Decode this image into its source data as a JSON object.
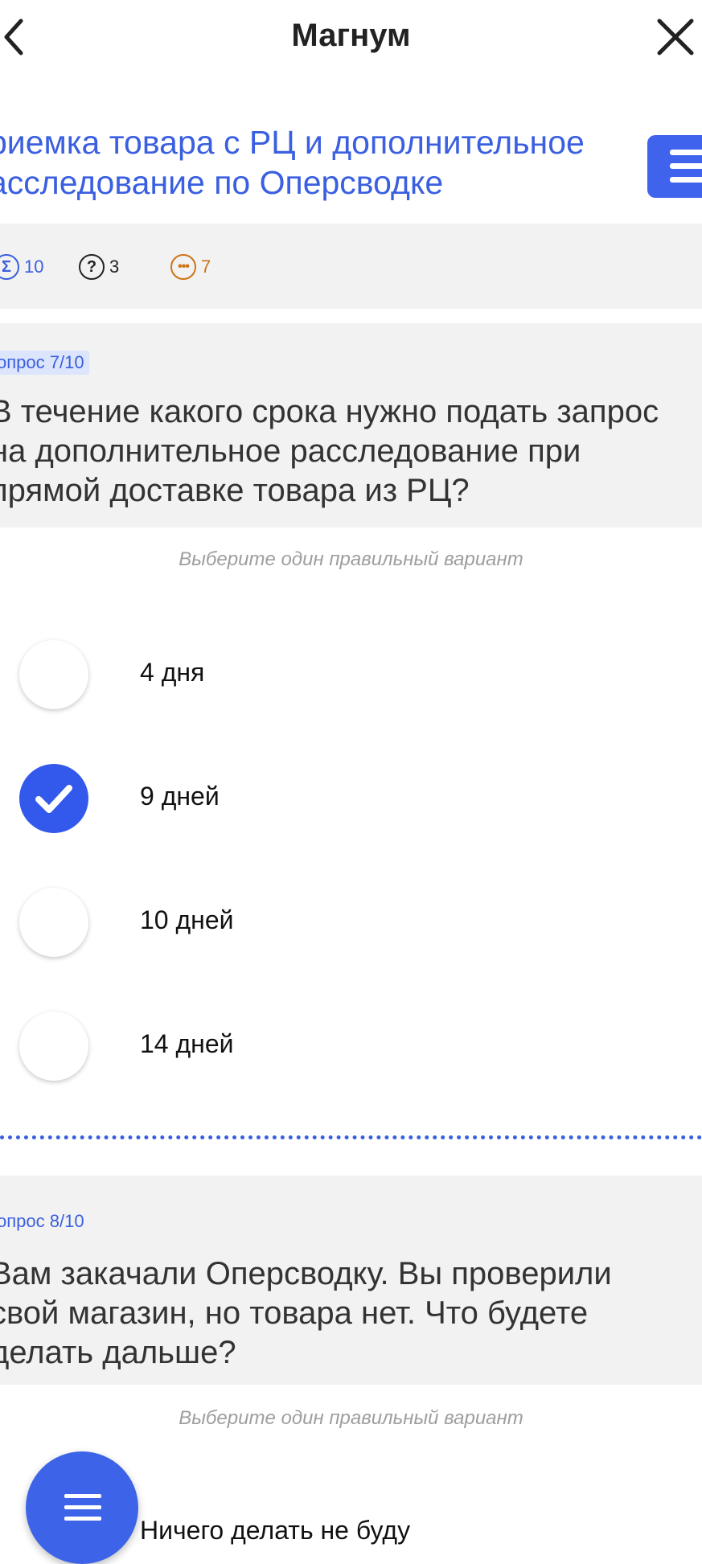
{
  "header": {
    "title": "Магнум"
  },
  "course": {
    "title_line1": "риемка товара с РЦ и дополнительное",
    "title_line2": "асследование по Оперсводке"
  },
  "stats": {
    "total": "10",
    "total_icon": "sigma-icon",
    "questions": "3",
    "questions_icon": "question-icon",
    "pending": "7",
    "pending_icon": "dots-icon"
  },
  "questions": [
    {
      "label": "опрос 7/10",
      "text_line1": "В течение какого срока нужно подать запрос",
      "text_line2": "на дополнительное расследование при",
      "text_line3": "прямой доставке товара из РЦ?",
      "hint": "Выберите один правильный вариант",
      "options": [
        {
          "label": "4 дня",
          "selected": false
        },
        {
          "label": "9 дней",
          "selected": true
        },
        {
          "label": "10 дней",
          "selected": false
        },
        {
          "label": "14 дней",
          "selected": false
        }
      ]
    },
    {
      "label": "опрос 8/10",
      "text_line1": "Вам закачали Оперсводку. Вы проверили",
      "text_line2": "свой магазин, но товара нет. Что будете",
      "text_line3": "делать дальше?",
      "hint": "Выберите один правильный вариант",
      "options": [
        {
          "label": "Ничего делать не буду",
          "selected": false
        }
      ]
    }
  ],
  "colors": {
    "accent": "#3a5fe0",
    "pending": "#cc7417",
    "panel": "#f2f2f2"
  }
}
